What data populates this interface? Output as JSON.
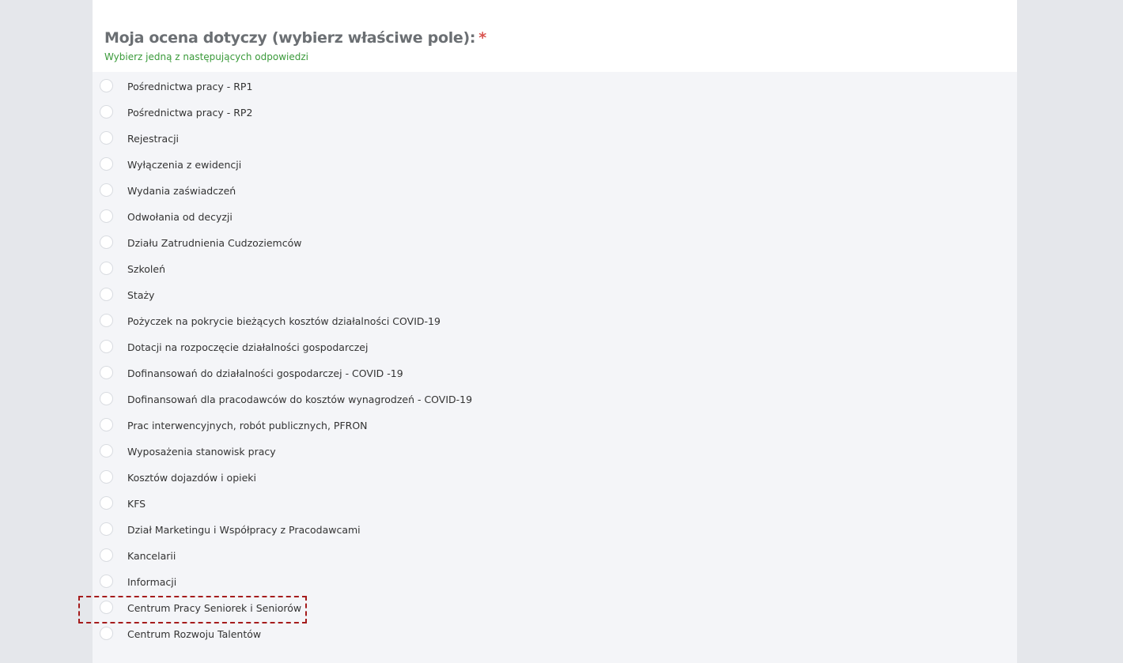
{
  "question": {
    "title": "Moja ocena dotyczy (wybierz właściwe pole):",
    "required_marker": "*",
    "help_text": "Wybierz jedną z następujących odpowiedzi"
  },
  "answers": [
    {
      "label": "Pośrednictwa pracy - RP1"
    },
    {
      "label": "Pośrednictwa pracy - RP2"
    },
    {
      "label": "Rejestracji"
    },
    {
      "label": "Wyłączenia z ewidencji"
    },
    {
      "label": "Wydania zaświadczeń"
    },
    {
      "label": "Odwołania od decyzji"
    },
    {
      "label": "Działu Zatrudnienia Cudzoziemców"
    },
    {
      "label": "Szkoleń"
    },
    {
      "label": "Staży"
    },
    {
      "label": "Pożyczek na pokrycie bieżących kosztów działalności COVID-19"
    },
    {
      "label": "Dotacji na rozpoczęcie działalności gospodarczej"
    },
    {
      "label": "Dofinansowań do działalności gospodarczej - COVID -19"
    },
    {
      "label": "Dofinansowań dla pracodawców do kosztów wynagrodzeń - COVID-19"
    },
    {
      "label": "Prac interwencyjnych, robót publicznych, PFRON"
    },
    {
      "label": "Wyposażenia stanowisk pracy"
    },
    {
      "label": "Kosztów dojazdów i opieki"
    },
    {
      "label": "KFS"
    },
    {
      "label": "Dział Marketingu i Współpracy z Pracodawcami"
    },
    {
      "label": "Kancelarii"
    },
    {
      "label": "Informacji"
    },
    {
      "label": "Centrum Pracy Seniorek i Seniorów"
    },
    {
      "label": "Centrum Rozwoju Talentów"
    }
  ],
  "colors": {
    "title": "#6b6f73",
    "required": "#d9534f",
    "help": "#3a9a3a",
    "highlight": "#a51c1c"
  }
}
